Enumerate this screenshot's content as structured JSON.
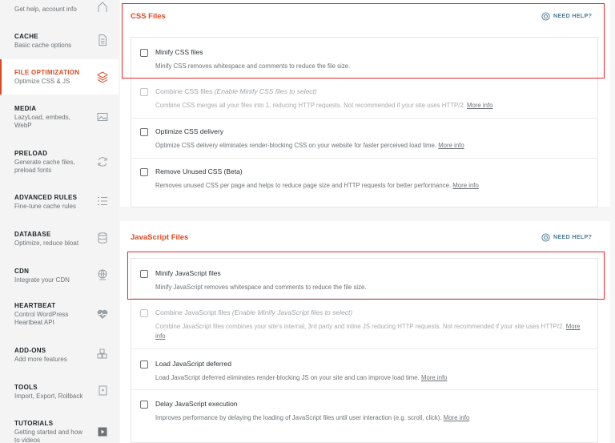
{
  "sidebar": {
    "items": [
      {
        "title": "",
        "sub": "Get help, account info",
        "icon": "home-icon"
      },
      {
        "title": "CACHE",
        "sub": "Basic cache options",
        "icon": "document-icon"
      },
      {
        "title": "FILE OPTIMIZATION",
        "sub": "Optimize CSS & JS",
        "icon": "layers-icon",
        "active": true
      },
      {
        "title": "MEDIA",
        "sub": "LazyLoad, embeds, WebP",
        "icon": "image-icon"
      },
      {
        "title": "PRELOAD",
        "sub": "Generate cache files, preload fonts",
        "icon": "refresh-icon"
      },
      {
        "title": "ADVANCED RULES",
        "sub": "Fine-tune cache rules",
        "icon": "list-icon"
      },
      {
        "title": "DATABASE",
        "sub": "Optimize, reduce bloat",
        "icon": "database-icon"
      },
      {
        "title": "CDN",
        "sub": "Integrate your CDN",
        "icon": "globe-icon"
      },
      {
        "title": "HEARTBEAT",
        "sub": "Control WordPress Heartbeat API",
        "icon": "heartbeat-icon"
      },
      {
        "title": "ADD-ONS",
        "sub": "Add more features",
        "icon": "cubes-icon"
      },
      {
        "title": "TOOLS",
        "sub": "Import, Export, Rollback",
        "icon": "tools-icon"
      },
      {
        "title": "TUTORIALS",
        "sub": "Getting started and how to videos",
        "icon": "video-icon"
      }
    ]
  },
  "css": {
    "title": "CSS Files",
    "help": "NEED HELP?",
    "options": [
      {
        "title": "Minify CSS files",
        "title_note": "",
        "desc": "Minify CSS removes whitespace and comments to reduce the file size.",
        "more": "",
        "disabled": false
      },
      {
        "title": "Combine CSS files",
        "title_note": "(Enable Minify CSS files to select)",
        "desc": "Combine CSS merges all your files into 1, reducing HTTP requests. Not recommended if your site uses HTTP/2.",
        "more": "More info",
        "disabled": true
      },
      {
        "title": "Optimize CSS delivery",
        "title_note": "",
        "desc": "Optimize CSS delivery eliminates render-blocking CSS on your website for faster perceived load time.",
        "more": "More info",
        "disabled": false
      },
      {
        "title": "Remove Unused CSS (Beta)",
        "title_note": "",
        "desc": "Removes unused CSS per page and helps to reduce page size and HTTP requests for better performance.",
        "more": "More info",
        "disabled": false
      }
    ]
  },
  "js": {
    "title": "JavaScript Files",
    "help": "NEED HELP?",
    "options": [
      {
        "title": "Minify JavaScript files",
        "title_note": "",
        "desc": "Minify JavaScript removes whitespace and comments to reduce the file size.",
        "more": "",
        "disabled": false
      },
      {
        "title": "Combine JavaScript files",
        "title_note": "(Enable Minify JavaScript files to select)",
        "desc": "Combine JavaScript files combines your site's internal, 3rd party and inline JS reducing HTTP requests. Not recommended if your site uses HTTP/2.",
        "more": "More info",
        "disabled": true
      },
      {
        "title": "Load JavaScript deferred",
        "title_note": "",
        "desc": "Load JavaScript deferred eliminates render-blocking JS on your site and can improve load time.",
        "more": "More info",
        "disabled": false
      },
      {
        "title": "Delay JavaScript execution",
        "title_note": "",
        "desc": "Improves performance by delaying the loading of JavaScript files until user interaction (e.g. scroll, click).",
        "more": "More info",
        "disabled": false
      }
    ]
  },
  "colors": {
    "accent": "#e2471f",
    "highlight": "#e3262c",
    "help": "#467896"
  }
}
